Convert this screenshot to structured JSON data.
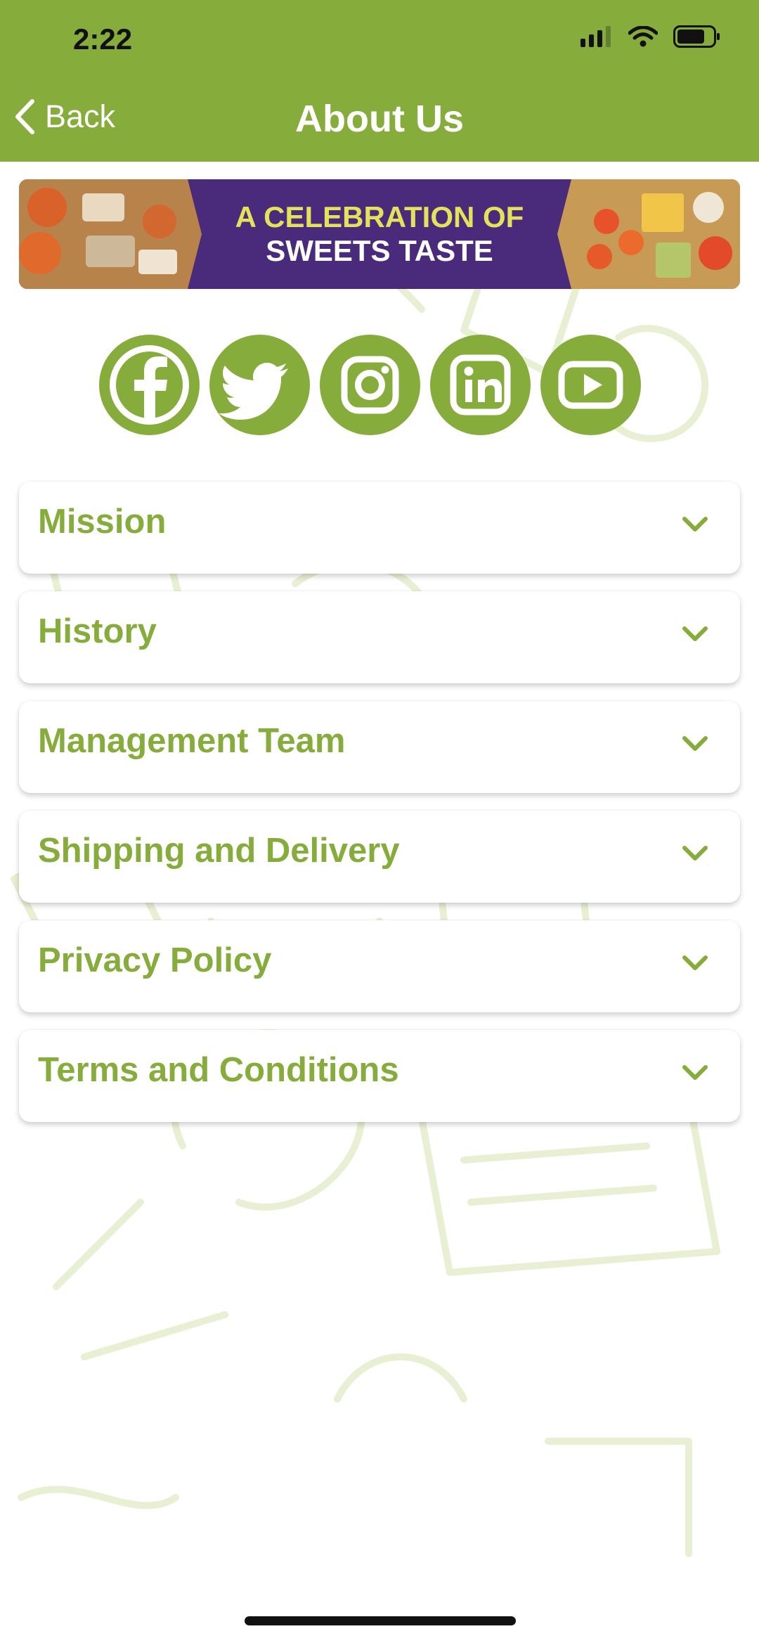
{
  "status_bar": {
    "time": "2:22"
  },
  "nav": {
    "back_label": "Back",
    "title": "About Us"
  },
  "banner": {
    "line1": "A CELEBRATION OF",
    "line2": "SWEETS TASTE"
  },
  "social": [
    {
      "name": "facebook",
      "icon": "facebook-icon"
    },
    {
      "name": "twitter",
      "icon": "twitter-icon"
    },
    {
      "name": "instagram",
      "icon": "instagram-icon"
    },
    {
      "name": "linkedin",
      "icon": "linkedin-icon"
    },
    {
      "name": "youtube",
      "icon": "youtube-icon"
    }
  ],
  "sections": [
    {
      "label": "Mission"
    },
    {
      "label": "History"
    },
    {
      "label": "Management Team"
    },
    {
      "label": "Shipping and Delivery"
    },
    {
      "label": "Privacy Policy"
    },
    {
      "label": "Terms and Conditions"
    }
  ],
  "colors": {
    "brand_green": "#86ac3c",
    "banner_purple": "#4a2a7a"
  }
}
